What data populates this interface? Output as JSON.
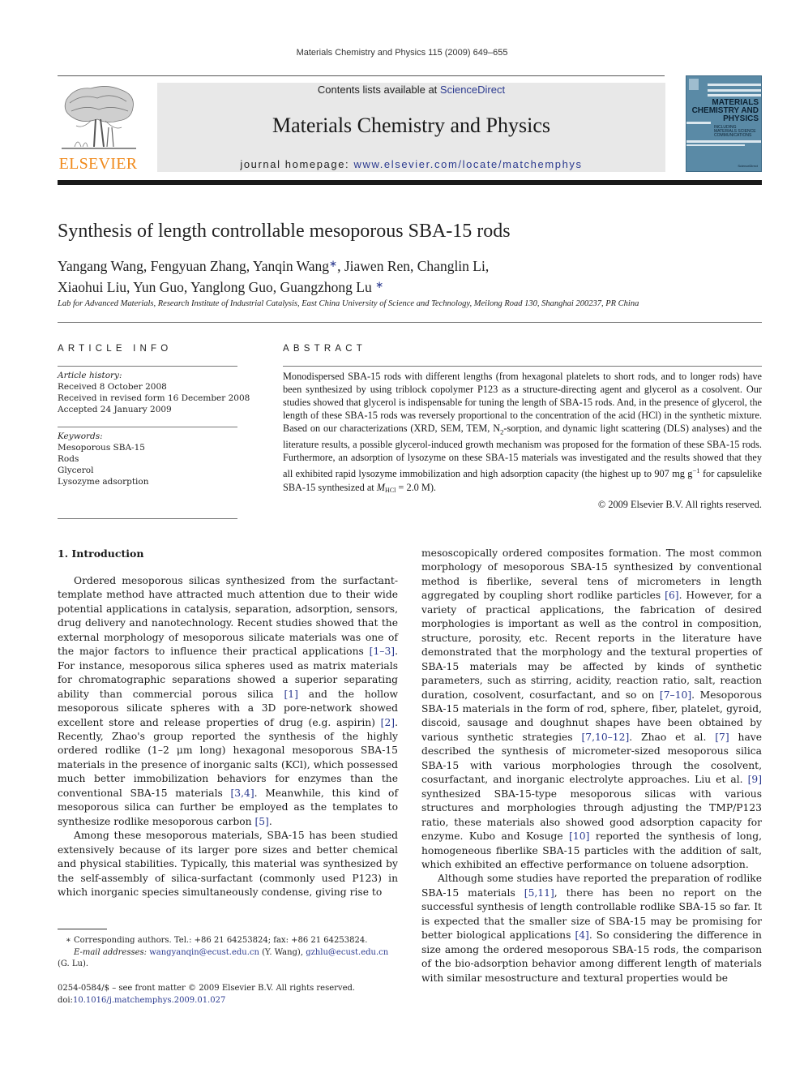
{
  "header": {
    "running_head": "Materials Chemistry and Physics 115 (2009) 649–655",
    "contents_prefix": "Contents lists available at ",
    "contents_link": "ScienceDirect",
    "journal_title": "Materials Chemistry and Physics",
    "homepage_prefix": "journal homepage: ",
    "homepage_url": "www.elsevier.com/locate/matchemphys",
    "publisher_logo_text": "ELSEVIER",
    "cover": {
      "title_lines": [
        "MATERIALS",
        "CHEMISTRY AND",
        "PHYSICS"
      ],
      "subtitle_lines": [
        "INCLUDING",
        "MATERIALS SCIENCE",
        "COMMUNICATIONS"
      ],
      "publisher": "ScienceDirect"
    },
    "colors": {
      "brand_orange": "#f08a1c",
      "link_blue": "#2b3a8f",
      "cover_blue": "#5a8aa6",
      "banner_gray": "#e8e8e8"
    }
  },
  "article": {
    "title": "Synthesis of length controllable mesoporous SBA-15 rods",
    "authors_line1": "Yangang Wang, Fengyuan Zhang, Yanqin Wang",
    "authors_line1_b": ", Jiawen Ren, Changlin Li,",
    "authors_line2": "Xiaohui Liu, Yun Guo, Yanglong Guo, Guangzhong Lu ",
    "corresponding_mark": "∗",
    "affiliation": "Lab for Advanced Materials, Research Institute of Industrial Catalysis, East China University of Science and Technology, Meilong Road 130, Shanghai 200237, PR China"
  },
  "article_info": {
    "heading": "ARTICLE INFO",
    "history_label": "Article history:",
    "history": [
      "Received 8 October 2008",
      "Received in revised form 16 December 2008",
      "Accepted 24 January 2009"
    ],
    "keywords_label": "Keywords:",
    "keywords": [
      "Mesoporous SBA-15",
      "Rods",
      "Glycerol",
      "Lysozyme adsorption"
    ]
  },
  "abstract": {
    "heading": "ABSTRACT",
    "text_part1": "Monodispersed SBA-15 rods with different lengths (from hexagonal platelets to short rods, and to longer rods) have been synthesized by using triblock copolymer P123 as a structure-directing agent and glycerol as a cosolvent. Our studies showed that glycerol is indispensable for tuning the length of SBA-15 rods. And, in the presence of glycerol, the length of these SBA-15 rods was reversely proportional to the concentration of the acid (HCl) in the synthetic mixture. Based on our characterizations (XRD, SEM, TEM, N",
    "n2_sub": "2",
    "text_part2": "-sorption, and dynamic light scattering (DLS) analyses) and the literature results, a possible glycerol-induced growth mechanism was proposed for the formation of these SBA-15 rods. Furthermore, an adsorption of lysozyme on these SBA-15 materials was investigated and the results showed that they all exhibited rapid lysozyme immobilization and high adsorption capacity (the highest up to 907 mg g",
    "sup_minus1": "−1",
    "text_part3": " for capsulelike SBA-15 synthesized at ",
    "m_symbol": "M",
    "m_sub": "HCl",
    "text_part4": " = 2.0 M).",
    "copyright": "© 2009 Elsevier B.V. All rights reserved."
  },
  "introduction": {
    "heading": "1.  Introduction",
    "p1": [
      {
        "t": "Ordered mesoporous silicas synthesized from the surfactant-template method have attracted much attention due to their wide potential applications in catalysis, separation, adsorption, sensors, drug delivery and nanotechnology. Recent studies showed that the external morphology of mesoporous silicate materials was one of the major factors to influence their practical applications "
      },
      {
        "ref": "[1–3]"
      },
      {
        "t": ". For instance, mesoporous silica spheres used as matrix materials for chromatographic separations showed a superior separating ability than commercial porous silica "
      },
      {
        "ref": "[1]"
      },
      {
        "t": " and the hollow mesoporous silicate spheres with a 3D pore-network showed excellent store and release properties of drug (e.g. aspirin) "
      },
      {
        "ref": "[2]"
      },
      {
        "t": ". Recently, Zhao's group reported the synthesis of the highly ordered rodlike (1–2 μm long) hexagonal mesoporous SBA-15 materials in the presence of inorganic salts (KCl), which possessed much better immobilization behaviors for enzymes than the conventional SBA-15 materials "
      },
      {
        "ref": "[3,4]"
      },
      {
        "t": ". Meanwhile, this kind of mesoporous silica can further be employed as the templates to synthesize rodlike mesoporous carbon "
      },
      {
        "ref": "[5]"
      },
      {
        "t": "."
      }
    ],
    "p2": [
      {
        "t": "Among these mesoporous materials, SBA-15 has been studied extensively because of its larger pore sizes and better chemical and physical stabilities. Typically, this material was synthesized by the self-assembly of silica-surfactant (commonly used P123) in which inorganic species simultaneously condense, giving rise to mesoscopically ordered composites formation. The most common morphology of mesoporous SBA-15 synthesized by conventional method is fiberlike, several tens of micrometers in length aggregated by coupling short rodlike particles "
      },
      {
        "ref": "[6]"
      },
      {
        "t": ". However, for a variety of practical applications, the fabrication of desired morphologies is important as well as the control in composition, structure, porosity, etc. Recent reports in the literature have demonstrated that the morphology and the textural properties of SBA-15 materials may be affected by kinds of synthetic parameters, such as stirring, acidity, reaction ratio, salt, reaction duration, cosolvent, cosurfactant, and so on "
      },
      {
        "ref": "[7–10]"
      },
      {
        "t": ". Mesoporous SBA-15 materials in the form of rod, sphere, fiber, platelet, gyroid, discoid, sausage and doughnut shapes have been obtained by various synthetic strategies "
      },
      {
        "ref": "[7,10–12]"
      },
      {
        "t": ". Zhao et al. "
      },
      {
        "ref": "[7]"
      },
      {
        "t": " have described the synthesis of micrometer-sized mesoporous silica SBA-15 with various morphologies through the cosolvent, cosurfactant, and inorganic electrolyte approaches. Liu et al. "
      },
      {
        "ref": "[9]"
      },
      {
        "t": " synthesized SBA-15-type mesoporous silicas with various structures and morphologies through adjusting the TMP/P123 ratio, these materials also showed good adsorption capacity for enzyme. Kubo and Kosuge "
      },
      {
        "ref": "[10]"
      },
      {
        "t": " reported the synthesis of long, homogeneous fiberlike SBA-15 particles with the addition of salt, which exhibited an effective performance on toluene adsorption."
      }
    ],
    "p3": [
      {
        "t": "Although some studies have reported the preparation of rodlike SBA-15 materials "
      },
      {
        "ref": "[5,11]"
      },
      {
        "t": ", there has been no report on the successful synthesis of length controllable rodlike SBA-15 so far. It is expected that the smaller size of SBA-15 may be promising for better biological applications "
      },
      {
        "ref": "[4]"
      },
      {
        "t": ". So considering the difference in size among the ordered mesoporous SBA-15 rods, the comparison of the bio-adsorption behavior among different length of materials with similar mesostructure and textural properties would be"
      }
    ]
  },
  "footnote": {
    "mark": "∗",
    "text": " Corresponding authors. Tel.: +86 21 64253824; fax: +86 21 64253824.",
    "email_label": "E-mail addresses: ",
    "email1": "wangyanqin@ecust.edu.cn",
    "email1_owner": " (Y. Wang), ",
    "email2": "gzhlu@ecust.edu.cn",
    "email2_owner": "(G. Lu)."
  },
  "front_matter": {
    "issn_line": "0254-0584/$ – see front matter © 2009 Elsevier B.V. All rights reserved.",
    "doi_prefix": "doi:",
    "doi": "10.1016/j.matchemphys.2009.01.027"
  }
}
